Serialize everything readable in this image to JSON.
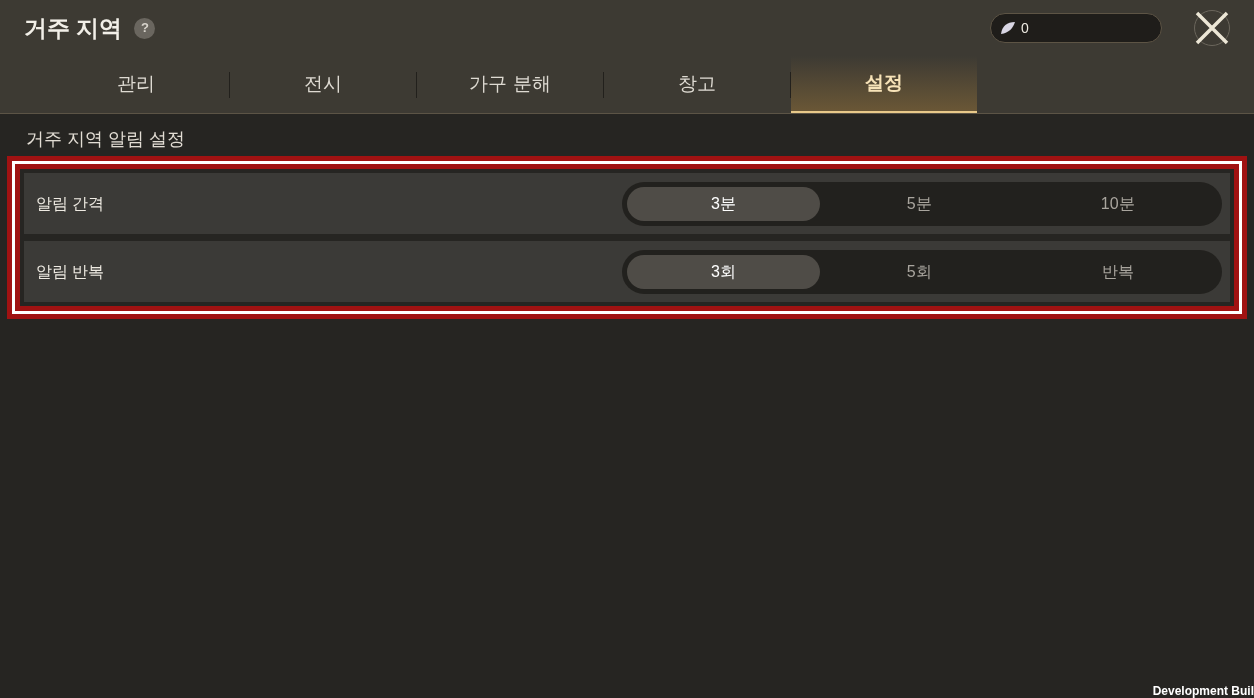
{
  "window": {
    "title": "거주 지역",
    "help": "?"
  },
  "currency": {
    "amount": "0"
  },
  "tabs": [
    {
      "label": "관리",
      "selected": false
    },
    {
      "label": "전시",
      "selected": false
    },
    {
      "label": "가구 분해",
      "selected": false
    },
    {
      "label": "창고",
      "selected": false
    },
    {
      "label": "설정",
      "selected": true
    }
  ],
  "section": {
    "title": "거주 지역 알림 설정",
    "highlighted": true
  },
  "settings": [
    {
      "label": "알림 간격",
      "options": [
        {
          "label": "3분",
          "selected": true
        },
        {
          "label": "5분",
          "selected": false
        },
        {
          "label": "10분",
          "selected": false
        }
      ]
    },
    {
      "label": "알림 반복",
      "options": [
        {
          "label": "3회",
          "selected": true
        },
        {
          "label": "5회",
          "selected": false
        },
        {
          "label": "반복",
          "selected": false
        }
      ]
    }
  ],
  "build_label": "Development Buil"
}
